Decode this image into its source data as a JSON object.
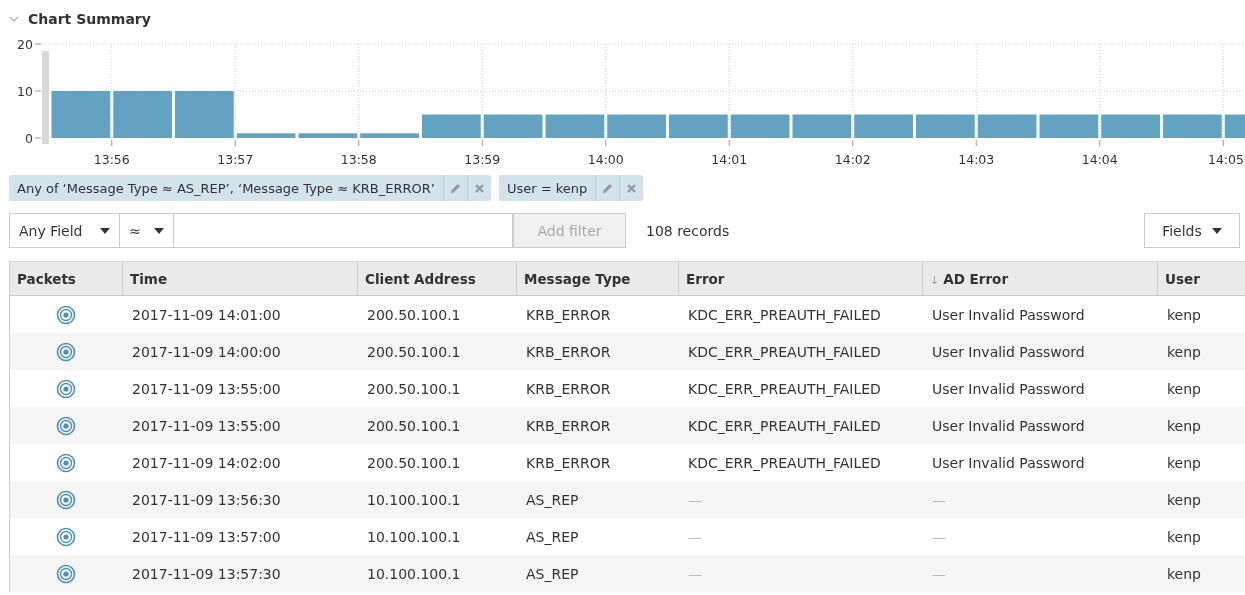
{
  "section": {
    "title": "Chart Summary",
    "expanded": true
  },
  "chart_data": {
    "type": "bar",
    "categories": [
      null,
      "13:56",
      null,
      "13:57",
      null,
      "13:58",
      null,
      "13:59",
      null,
      "14:00",
      null,
      "14:01",
      null,
      "14:02",
      null,
      "14:03",
      null,
      "14:04",
      null,
      "14:05"
    ],
    "values": [
      10,
      10,
      10,
      1,
      1,
      1,
      5,
      5,
      5,
      5,
      5,
      5,
      5,
      5,
      5,
      5,
      5,
      5,
      5,
      5
    ],
    "ylim": [
      0,
      20
    ],
    "yticks": [
      0,
      10,
      20
    ],
    "grid": true
  },
  "filters": [
    {
      "label": "Any of ‘Message Type ≈ AS_REP’, ‘Message Type ≈ KRB_ERROR’"
    },
    {
      "label": "User = kenp"
    }
  ],
  "filter_bar": {
    "field": "Any Field",
    "operator": "≈",
    "button": "Add filter",
    "disabled": true,
    "count": "108 records",
    "fields_button": "Fields"
  },
  "table": {
    "columns": [
      {
        "label": "Packets"
      },
      {
        "label": "Time"
      },
      {
        "label": "Client Address"
      },
      {
        "label": "Message Type"
      },
      {
        "label": "Error"
      },
      {
        "label": "AD Error",
        "sort_arrow": "↓"
      },
      {
        "label": "User"
      }
    ],
    "rows": [
      {
        "time": "2017-11-09 14:01:00",
        "client": "200.50.100.1",
        "message_type": "KRB_ERROR",
        "error": "KDC_ERR_PREAUTH_FAILED",
        "ad_error": "User Invalid Password",
        "user": "kenp"
      },
      {
        "time": "2017-11-09 14:00:00",
        "client": "200.50.100.1",
        "message_type": "KRB_ERROR",
        "error": "KDC_ERR_PREAUTH_FAILED",
        "ad_error": "User Invalid Password",
        "user": "kenp"
      },
      {
        "time": "2017-11-09 13:55:00",
        "client": "200.50.100.1",
        "message_type": "KRB_ERROR",
        "error": "KDC_ERR_PREAUTH_FAILED",
        "ad_error": "User Invalid Password",
        "user": "kenp"
      },
      {
        "time": "2017-11-09 13:55:00",
        "client": "200.50.100.1",
        "message_type": "KRB_ERROR",
        "error": "KDC_ERR_PREAUTH_FAILED",
        "ad_error": "User Invalid Password",
        "user": "kenp"
      },
      {
        "time": "2017-11-09 14:02:00",
        "client": "200.50.100.1",
        "message_type": "KRB_ERROR",
        "error": "KDC_ERR_PREAUTH_FAILED",
        "ad_error": "User Invalid Password",
        "user": "kenp"
      },
      {
        "time": "2017-11-09 13:56:30",
        "client": "10.100.100.1",
        "message_type": "AS_REP",
        "error": "—",
        "ad_error": "—",
        "user": "kenp"
      },
      {
        "time": "2017-11-09 13:57:00",
        "client": "10.100.100.1",
        "message_type": "AS_REP",
        "error": "—",
        "ad_error": "—",
        "user": "kenp"
      },
      {
        "time": "2017-11-09 13:57:30",
        "client": "10.100.100.1",
        "message_type": "AS_REP",
        "error": "—",
        "ad_error": "—",
        "user": "kenp"
      }
    ]
  }
}
